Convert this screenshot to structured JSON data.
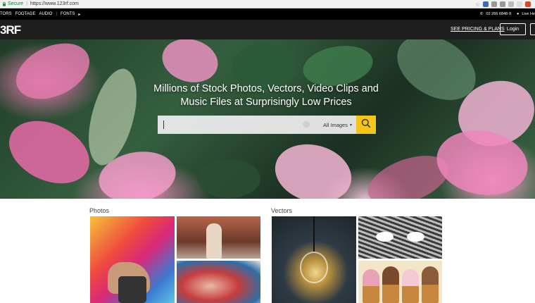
{
  "browser": {
    "secure_label": "Secure",
    "url": "https://www.123rf.com"
  },
  "topbar": {
    "nav": [
      "TORS",
      "FOOTAGE",
      "AUDIO",
      "FONTS"
    ],
    "phone": "02 266 6848-9",
    "live_help": "Live He"
  },
  "header": {
    "logo": "3RF",
    "pricing_link": "SEE PRICING & PLANS",
    "login_label": "Login"
  },
  "hero": {
    "headline_line1": "Millions of Stock Photos, Vectors, Video Clips and",
    "headline_line2": "Music Files at Surprisingly Low Prices",
    "search_placeholder": "",
    "search_type": "All Images"
  },
  "sections": {
    "photos_title": "Photos",
    "vectors_title": "Vectors"
  },
  "colors": {
    "accent_yellow": "#f5c518",
    "header_bg": "#1e1e1e"
  },
  "icons": [
    "lock-icon",
    "search-icon",
    "camera-icon",
    "dropdown-caret-icon",
    "phone-icon",
    "chat-icon"
  ]
}
